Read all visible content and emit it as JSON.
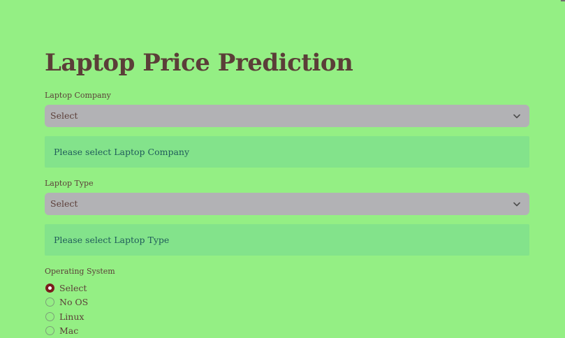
{
  "page": {
    "title": "Laptop Price Prediction"
  },
  "company": {
    "label": "Laptop Company",
    "selected": "Select",
    "alert": "Please select Laptop Company"
  },
  "type": {
    "label": "Laptop Type",
    "selected": "Select",
    "alert": "Please select Laptop Type"
  },
  "os": {
    "label": "Operating System",
    "options": [
      "Select",
      "No OS",
      "Linux",
      "Mac"
    ],
    "selected_index": 0
  },
  "colors": {
    "background": "#94ef84",
    "select_background": "#b2b2b5",
    "alert_background": "#83e38b",
    "title_text": "#5b3e38",
    "alert_text": "#1f5b5a",
    "radio_checked": "#7b1d1d"
  },
  "icons": {
    "dropdown": "chevron-down-icon",
    "radio_selected": "radio-selected-icon",
    "radio_unselected": "radio-unselected-icon"
  }
}
